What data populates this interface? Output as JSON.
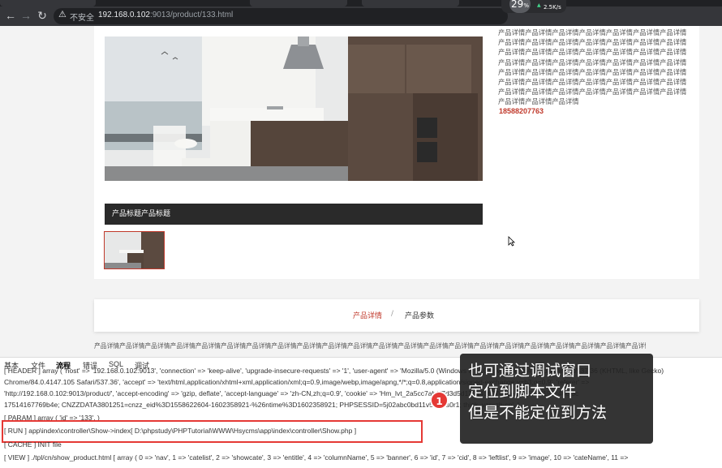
{
  "browser": {
    "back_icon": "back-arrow-icon",
    "forward_icon": "forward-arrow-icon",
    "reload_icon": "reload-icon",
    "security_icon": "warning-triangle-icon",
    "insecure_label": "不安全",
    "url_host": "192.168.0.102",
    "url_rest": ":9013/product/133.html",
    "speed_percent": "29",
    "speed_percent_unit": "%",
    "speed_rate": "2.5K/s"
  },
  "product": {
    "caption": "产品标题产品标题",
    "description": "产品详情产品详情产品详情产品详情产品详情产品详情产品详情产品详情产品详情产品详情产品详情产品详情产品详情产品详情产品详情产品详情产品详情产品详情产品详情产品详情产品详情产品详情产品详情产品详情产品详情产品详情产品详情产品详情产品详情产品详情产品详情产品详情产品详情产品详情产品详情产品详情产品详情产品详情产品详情产品详情产品详情产品详情产品详情产品详情产品详情产品详情产品详情产品详情产品详情产品详情产品详情产品详情",
    "phone": "18588207763"
  },
  "detail_tabs": {
    "tab1": "产品详情",
    "separator": "/",
    "tab2": "产品参数"
  },
  "detail_text": "产品详情产品详情产品详情产品详情产品详情产品详情产品详情产品详情产品详情产品详情产品详情产品详情产品详情产品详情产品详情产品详情产品详情产品详情产品详情产品详情产品详情产品详情产品详情产品详情产品详情产品详情产品详情产品详情",
  "trace": {
    "tabs": [
      "基本",
      "文件",
      "流程",
      "错误",
      "SQL",
      "调试"
    ],
    "active_tab": "流程",
    "lines": [
      "[ HEADER ] array ( 'host' => '192.168.0.102:9013', 'connection' => 'keep-alive', 'upgrade-insecure-requests' => '1', 'user-agent' => 'Mozilla/5.0 (Windows NT 10.0; Win64; x64) AppleWebKit/537.36 (KHTML, like Gecko)",
      "Chrome/84.0.4147.105 Safari/537.36', 'accept' => 'text/html,application/xhtml+xml,application/xml;q=0.9,image/webp,image/apng,*/*;q=0.8,application/signed-exchange;v=b3;q=0.9', 'referer' =>",
      "'http://192.168.0.102:9013/product/', 'accept-encoding' => 'gzip, deflate', 'accept-language' => 'zh-CN,zh;q=0.9', 'cookie' => 'Hm_lvt_2a5cc7ab1f7d3d5d17514167762be-0565119193c46c-3c",
      "17514167769b4e; CNZZDATA3801251=cnzz_eid%3D1558622604-1602358921-%26ntime%3D1602358921; PHPSESSID=5j02abc0bd11v5f0c8s0r1; think_var=zh-cn', )",
      "[ PARAM ] array ( 'id' => '133', )",
      "[ RUN ] app\\index\\controller\\Show->index[ D:\\phpstudy\\PHPTutorial\\WWW\\Hsycms\\app\\index\\controller\\Show.php ]",
      "[ CACHE ] INIT file",
      "[ VIEW ] ./tpl/cn/show_product.html [ array ( 0 => 'nav', 1 => 'catelist', 2 => 'showcate', 3 => 'entitle', 4 => 'columnName', 5 => 'banner', 6 => 'id', 7 => 'cid', 8 => 'leftlist', 9 => 'image', 10 => 'cateName', 11 =>"
    ]
  },
  "annotation": {
    "badge": "1",
    "line1": "也可通过调试窗口",
    "line2": "定位到脚本文件",
    "line3": "但是不能定位到方法"
  }
}
